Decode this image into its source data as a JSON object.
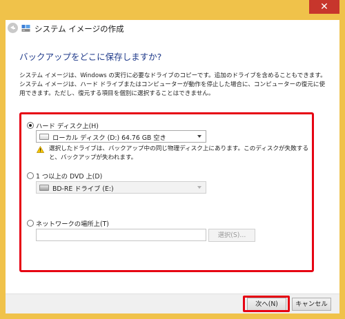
{
  "window": {
    "title": "システム イメージの作成",
    "close_glyph": "✕",
    "frame_color": "#f0c24a",
    "close_color": "#c7362c"
  },
  "page": {
    "heading": "バックアップをどこに保存しますか?",
    "description": "システム イメージは、Windows の実行に必要なドライブのコピーです。追加のドライブを含めることもできます。システム イメージは、ハード ドライブまたはコンピューターが動作を停止した場合に、コンピューターの復元に使用できます。ただし、復元する項目を個別に選択することはできません。"
  },
  "options": {
    "hard_disk": {
      "label": "ハード ディスク上(H)",
      "checked": true,
      "combo_value": "ローカル ディスク (D:)  64.76 GB 空き",
      "warning": "選択したドライブは、バックアップ中の同じ物理ディスク上にあります。このディスクが失敗すると、バックアップが失われます。"
    },
    "dvd": {
      "label": "1 つ以上の DVD 上(D)",
      "checked": false,
      "combo_value": "BD-RE ドライブ (E:)"
    },
    "network": {
      "label": "ネットワークの場所上(T)",
      "checked": false,
      "path_value": "",
      "select_label": "選択(S)..."
    }
  },
  "footer": {
    "next_label": "次へ(N)",
    "cancel_label": "キャンセル"
  },
  "highlight_color": "#e60012",
  "icons": {
    "back": "back-arrow-icon",
    "app": "system-image-icon",
    "drive": "hard-drive-icon",
    "bd_drive": "bd-drive-icon",
    "warning": "warning-icon"
  }
}
